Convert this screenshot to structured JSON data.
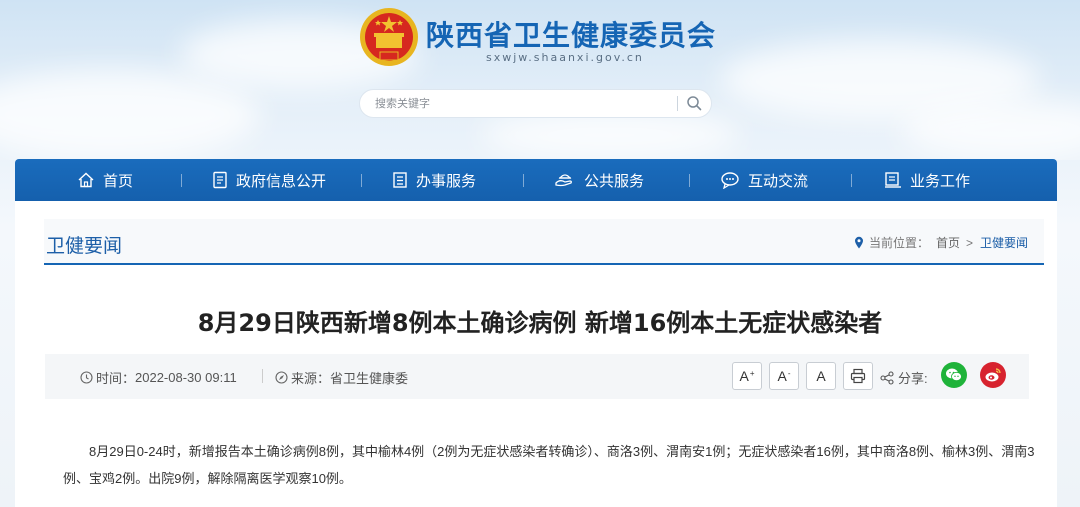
{
  "site": {
    "title": "陕西省卫生健康委员会",
    "domain": "sxwjw.shaanxi.gov.cn",
    "brand_color": "#1565b4",
    "emblem_icon": "national-emblem"
  },
  "search": {
    "placeholder": "搜索关键字",
    "value": "",
    "button_icon": "search-icon"
  },
  "nav": {
    "items": [
      {
        "label": "首页",
        "icon": "home-icon"
      },
      {
        "label": "政府信息公开",
        "icon": "document-icon"
      },
      {
        "label": "办事服务",
        "icon": "form-icon"
      },
      {
        "label": "公共服务",
        "icon": "service-icon"
      },
      {
        "label": "互动交流",
        "icon": "chat-icon"
      },
      {
        "label": "业务工作",
        "icon": "work-icon"
      }
    ]
  },
  "section": {
    "title": "卫健要闻",
    "breadcrumb": {
      "prefix": "当前位置：",
      "items": [
        "首页",
        "卫健要闻"
      ],
      "separator": ">"
    }
  },
  "article": {
    "title": "8月29日陕西新增8例本土确诊病例 新增16例本土无症状感染者",
    "meta": {
      "time_label": "时间：",
      "time_value": "2022-08-30 09:11",
      "source_label": "来源：",
      "source_value": "省卫生健康委"
    },
    "font_controls": {
      "increase": "A",
      "decrease": "A",
      "reset": "A"
    },
    "share": {
      "label": "分享:",
      "targets": [
        "wechat-icon",
        "weibo-icon"
      ]
    },
    "body": "8月29日0-24时，新增报告本土确诊病例8例，其中榆林4例（2例为无症状感染者转确诊）、商洛3例、渭南安1例；无症状感染者16例，其中商洛8例、榆林3例、渭南3例、宝鸡2例。出院9例，解除隔离医学观察10例。"
  }
}
